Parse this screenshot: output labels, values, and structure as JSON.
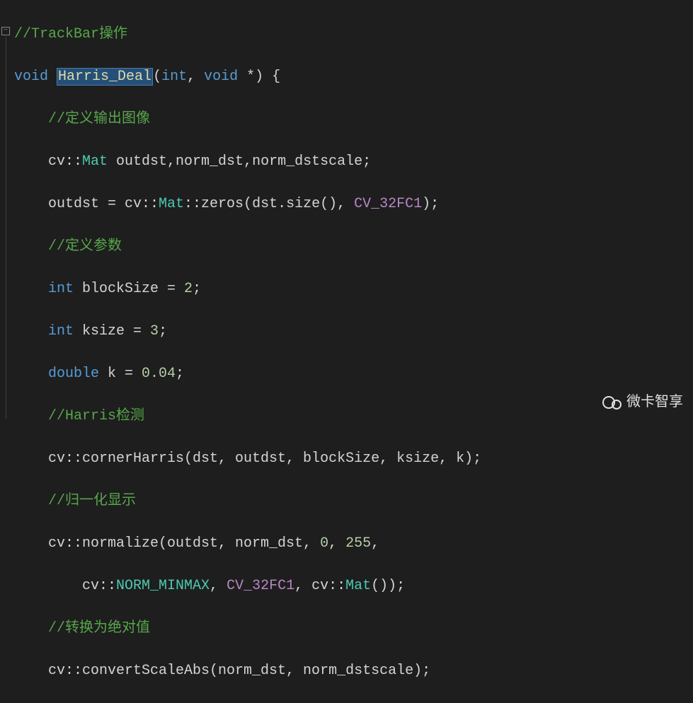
{
  "code": {
    "l1_comment": "//TrackBar操作",
    "l2_void": "void",
    "l2_fn": "Harris_Deal",
    "l2_int": "int",
    "l2_voidp": "void",
    "l2_star": " *",
    "l2_brace": ") {",
    "l3_comment": "//定义输出图像",
    "l4_ns": "cv::",
    "l4_mat": "Mat",
    "l4_vars": " outdst,norm_dst,norm_dstscale;",
    "l5_lhs": "outdst = cv::",
    "l5_mat": "Mat",
    "l5_zeros": "::zeros(dst.size(), ",
    "l5_const": "CV_32FC1",
    "l5_end": ");",
    "l6_comment": "//定义参数",
    "l7_int": "int",
    "l7_rest": " blockSize = ",
    "l7_num": "2",
    "l7_semi": ";",
    "l8_int": "int",
    "l8_rest": " ksize = ",
    "l8_num": "3",
    "l8_semi": ";",
    "l9_double": "double",
    "l9_rest": " k = ",
    "l9_num": "0.04",
    "l9_semi": ";",
    "l10_comment": "//Harris检测",
    "l11_call": "cv::cornerHarris(dst, outdst, blockSize, ksize, k);",
    "l12_comment": "//归一化显示",
    "l13_call": "cv::normalize(outdst, norm_dst, ",
    "l13_n0": "0",
    "l13_c1": ", ",
    "l13_n255": "255",
    "l13_c2": ",",
    "l14_pre": "cv::",
    "l14_nm": "NORM_MINMAX",
    "l14_c": ", ",
    "l14_const": "CV_32FC1",
    "l14_c2": ", cv::",
    "l14_mat": "Mat",
    "l14_end": "());",
    "l15_comment": "//转换为绝对值",
    "l16_call": "cv::convertScaleAbs(norm_dst, norm_dstscale);"
  },
  "fold_symbol": "−",
  "watermark_text": "微卡智享"
}
